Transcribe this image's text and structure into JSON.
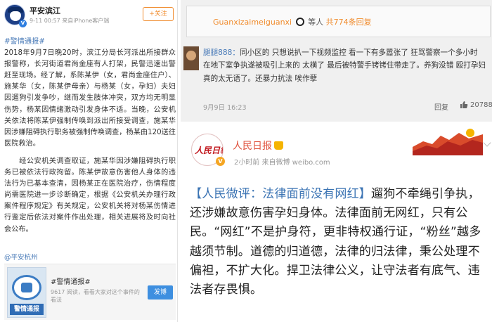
{
  "left": {
    "account_name": "平安滨江",
    "meta": "9-11 00:57  来自iPhone客户端",
    "follow_label": "+关注",
    "body_tag": "#警情通报#",
    "body_p1": "2018年9月7日晚20时，滨江分局长河派出所接群众报警称，长河街道君尚金座有人打架，民警迅速出警赶至现场。经了解，系陈某伊（女，君尚金座住户）、施某华（女，陈某伊母亲）与杨某（女，孕妇）夫妇因遛狗引发争吵，继而发生肢体冲突，双方均无明显伤势，杨某因情绪激动引发身体不适。当晚，公安机关依法将陈某伊强制传唤到派出所接受调查，施某华因涉嫌阻碍执行职务被强制传唤调查，杨某由120送往医院救治。",
    "body_p2": "经公安机关调查取证，施某华因涉嫌阻碍执行职务已被依法行政拘留。陈某伊故意伤害他人身体的违法行为已基本查清，因杨某正在医院治疗，伤情程度尚需医院进一步诊断确定，根据《公安机关办理行政案件程序规定》有关规定，公安机关将对杨某伤情进行鉴定后依法对案件作出处理，相关进展将及时向社会公布。",
    "source": "@平安杭州",
    "card": {
      "thumb_label": "警情通报",
      "title": "#警情通报#",
      "subtitle": "9617 阅读，看看大家对这个事件的看法",
      "post_label": "发博"
    }
  },
  "right_top": {
    "banner": {
      "user": "Guanxizaimeiguanxi",
      "middle": "等人",
      "count": "共774条回复"
    },
    "comment": {
      "user": "腿腿888：",
      "text": "同小区的 只想说扒一下视频监控 看一下有多嚣张了 狂骂警察一个多小时 在地下室争执遂被吸引上来的 太横了 最后被特警手铐铐住带走了。养狗没错 殴打孕妇真的太无语了。还暴力抗法 唉作孽",
      "time": "9月9日 16:23",
      "reply_label": "回复",
      "likes": "20788"
    }
  },
  "right_bottom": {
    "logo_text": "人民日報",
    "account_name": "人民日报",
    "meta": "2小时前  来自微博 weibo.com",
    "tag": "【人民微评：法律面前没有网红】",
    "text": "遛狗不牵绳引争执，还涉嫌故意伤害孕妇身体。法律面前无网红，只有公民。“网红”不是护身符，更非特权通行证，“粉丝”越多越须节制。道德的归道德，法律的归法律，秉公处理不偏袒，不扩大化。捍卫法律公义，让守法者有底气、违法者存畏惧。"
  },
  "colors": {
    "weibo_orange": "#f08b2c",
    "link_blue": "#4a7bb8",
    "peoples_daily_red": "#c0151b",
    "post_button_blue": "#3e8fe0"
  }
}
